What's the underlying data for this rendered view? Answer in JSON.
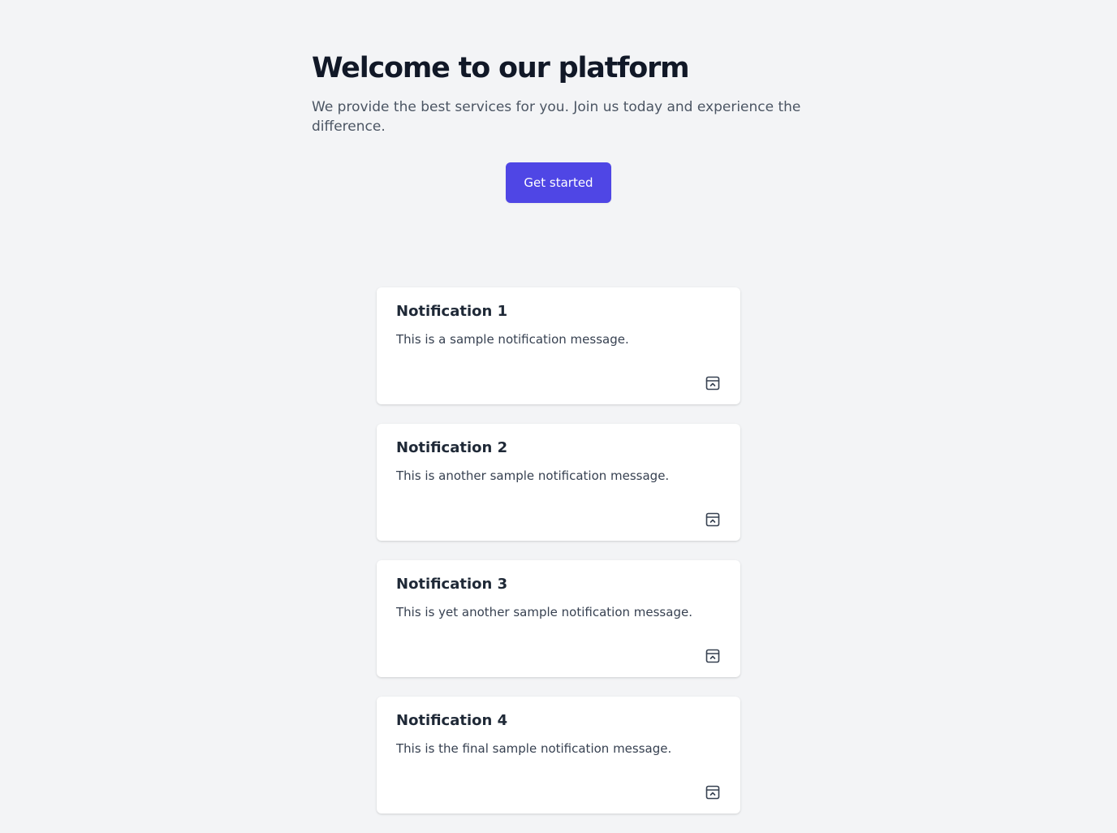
{
  "hero": {
    "title": "Welcome to our platform",
    "subtitle": "We provide the best services for you. Join us today and experience the difference.",
    "cta_label": "Get started"
  },
  "notifications": [
    {
      "title": "Notification 1",
      "message": "This is a sample notification message.",
      "action_icon": "archive-icon"
    },
    {
      "title": "Notification 2",
      "message": "This is another sample notification message.",
      "action_icon": "archive-icon"
    },
    {
      "title": "Notification 3",
      "message": "This is yet another sample notification message.",
      "action_icon": "archive-icon"
    },
    {
      "title": "Notification 4",
      "message": "This is the final sample notification message.",
      "action_icon": "archive-icon"
    }
  ],
  "colors": {
    "background": "#f3f4f6",
    "accent": "#4f46e5",
    "heading": "#111827",
    "body_text": "#4b5563",
    "card_bg": "#ffffff"
  }
}
